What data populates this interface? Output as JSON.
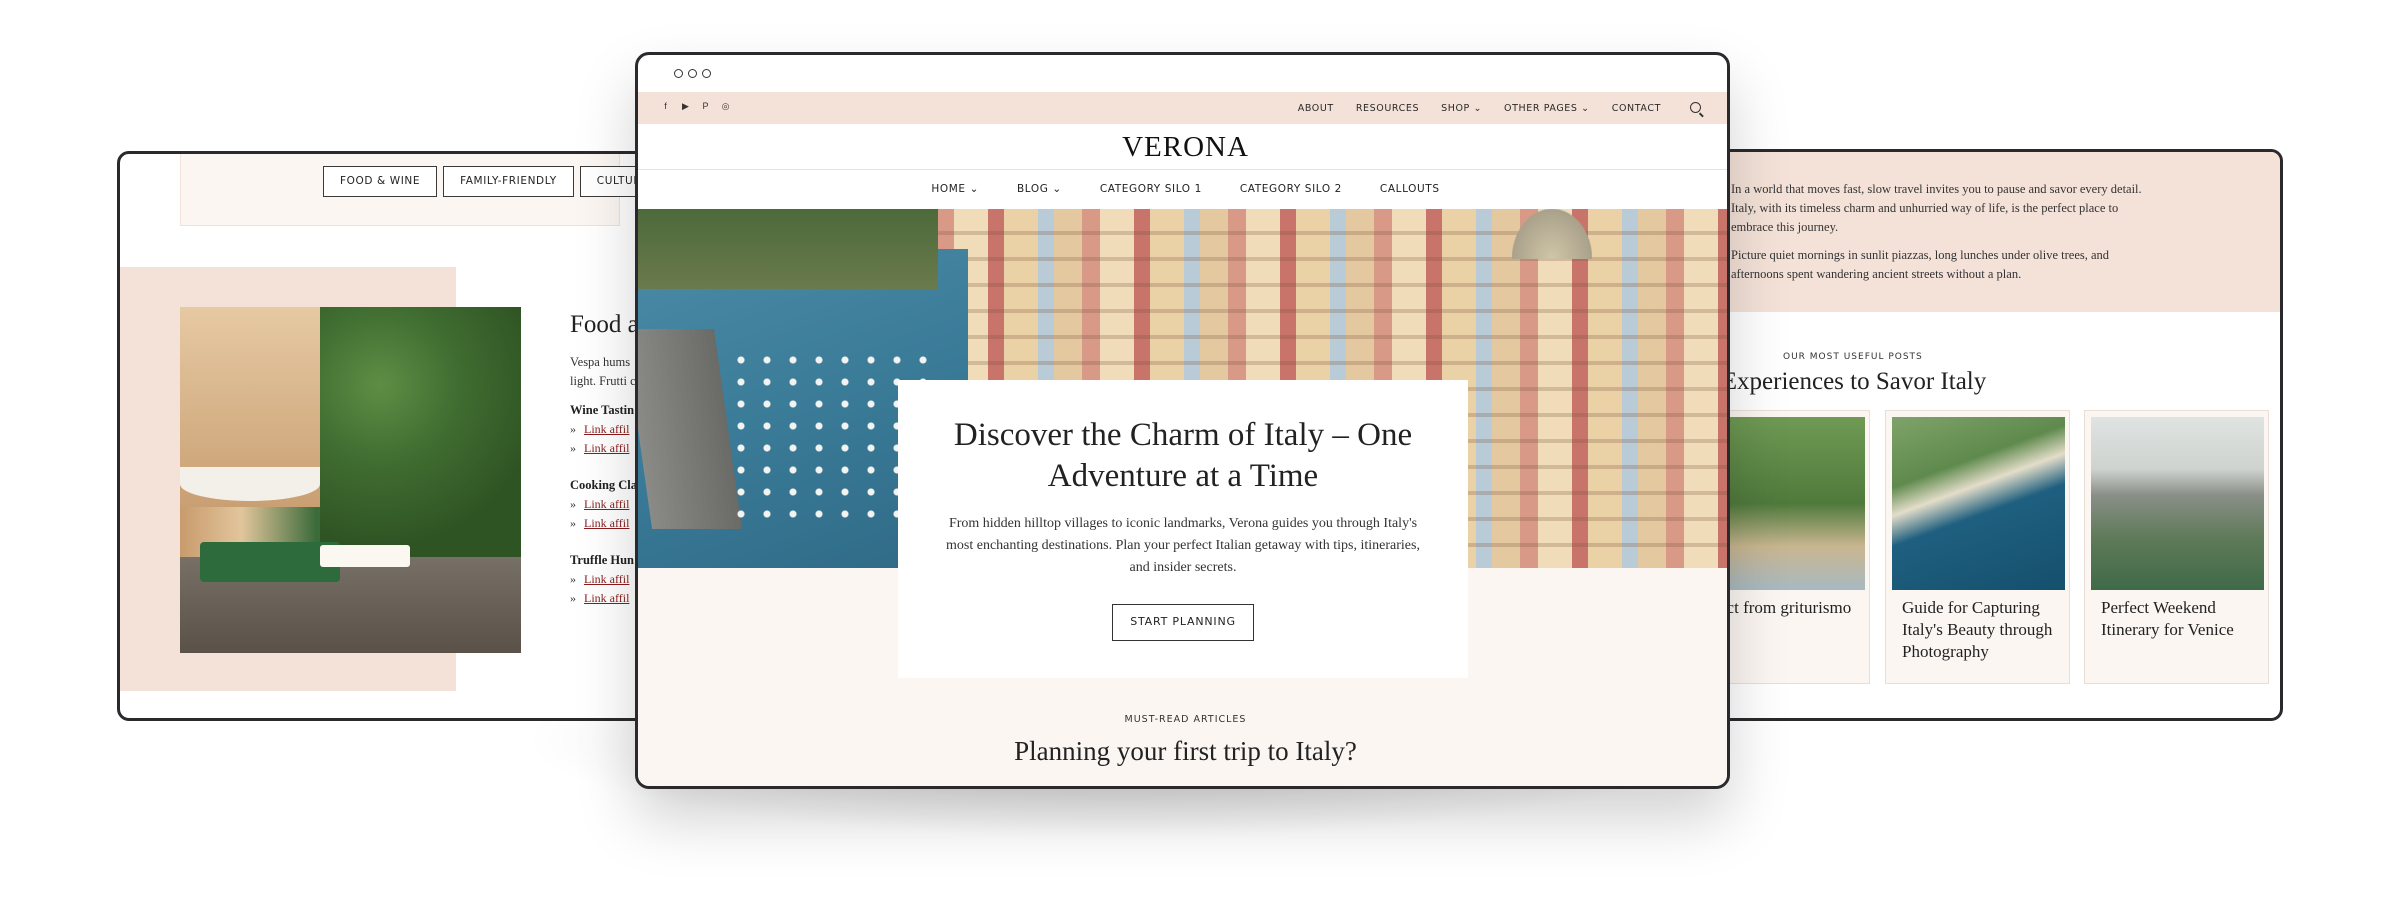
{
  "left_window": {
    "tags": [
      "FOOD & WINE",
      "FAMILY-FRIENDLY",
      "CULTURE"
    ],
    "title": "Food a",
    "body_lines": [
      "Vespa hums",
      "light. Frutti c"
    ],
    "sections": [
      {
        "heading": "Wine Tastin",
        "links": [
          "Link affil",
          "Link affil"
        ]
      },
      {
        "heading": "Cooking Cla",
        "links": [
          "Link affil",
          "Link affil"
        ]
      },
      {
        "heading": "Truffle Hun",
        "links": [
          "Link affil",
          "Link affil"
        ]
      }
    ],
    "bullet": "»"
  },
  "right_window": {
    "para1": "In a world that moves fast, slow travel invites you to pause and savor every detail. Italy, with its timeless charm and unhurried way of life, is the perfect place to embrace this journey.",
    "para2": "Picture quiet mornings in sunlit piazzas, long lunches under olive trees, and afternoons spent wandering ancient streets without a plan.",
    "eyebrow": "OUR MOST USEFUL POSTS",
    "heading": "d Experiences to Savor Italy",
    "cards": [
      {
        "title": "xpect from griturismo"
      },
      {
        "title": "Guide for Capturing Italy's Beauty through Photography"
      },
      {
        "title": "Perfect Weekend Itinerary for Venice"
      }
    ]
  },
  "main_window": {
    "topnav": [
      "ABOUT",
      "RESOURCES",
      "SHOP ⌄",
      "OTHER PAGES ⌄",
      "CONTACT"
    ],
    "social_icons": [
      "facebook-icon",
      "youtube-icon",
      "pinterest-icon",
      "instagram-icon"
    ],
    "logo": "VERONA",
    "mainnav": [
      "HOME ⌄",
      "BLOG ⌄",
      "CATEGORY SILO 1",
      "CATEGORY SILO 2",
      "CALLOUTS"
    ],
    "hero": {
      "heading": "Discover the Charm of Italy – One Adventure at a Time",
      "text": "From hidden hilltop villages to iconic landmarks, Verona guides you through Italy's most enchanting destinations. Plan your perfect Italian getaway with tips, itineraries, and insider secrets.",
      "cta": "START PLANNING"
    },
    "eyebrow": "MUST-READ ARTICLES",
    "section_heading": "Planning your first trip to Italy?"
  },
  "colors": {
    "accent_pink": "#f4e2d8",
    "cream": "#fcf6f2",
    "frame": "#2a2a2e",
    "link": "#8a1d1d"
  }
}
